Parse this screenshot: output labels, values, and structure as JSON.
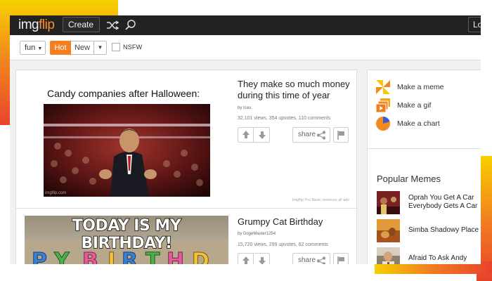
{
  "header": {
    "logo_part1": "img",
    "logo_part2": "flip",
    "create_label": "Create",
    "login_label": "Lo"
  },
  "filters": {
    "category": "fun",
    "hot": "Hot",
    "new": "New",
    "nsfw": "NSFW"
  },
  "posts": [
    {
      "caption": "Candy companies after Halloween:",
      "credit": "imgflip.com",
      "title": "They make so much money during this time of year",
      "author": "by Iceu.",
      "stats": "32,101 views, 354 upvotes, 110 comments",
      "share": "share",
      "ad_note": "Imgflip Pro Basic removes all ads"
    },
    {
      "top_text": "TODAY IS MY BIRTHDAY!",
      "title": "Grumpy Cat Birthday",
      "author": "by DogeMaster1254",
      "stats": "15,720 views, 299 upvotes, 62 comments",
      "share": "share"
    }
  ],
  "sidebar": {
    "make": [
      {
        "label": "Make a meme",
        "icon": "meme-pinwheel-icon"
      },
      {
        "label": "Make a gif",
        "icon": "gif-frames-icon"
      },
      {
        "label": "Make a chart",
        "icon": "pie-chart-icon"
      }
    ],
    "popular_title": "Popular Memes",
    "popular": [
      {
        "label": "Oprah You Get A Car Everybody Gets A Car"
      },
      {
        "label": "Simba Shadowy Place"
      },
      {
        "label": "Afraid To Ask Andy"
      }
    ]
  },
  "colors": {
    "accent_orange": "#f57f20",
    "nav_bg": "#222222",
    "logo_flip": "#ff8f2f"
  }
}
